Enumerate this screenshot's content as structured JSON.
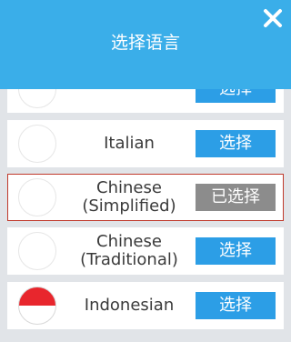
{
  "header": {
    "title": "选择语言",
    "close_icon": "close-icon"
  },
  "colors": {
    "header_bg": "#3aaee9",
    "list_bg": "#e1e4e8",
    "button_blue": "#2c9ee6",
    "button_selected": "#8c8c8c",
    "selected_border": "#c0392b"
  },
  "languages": [
    {
      "label": "",
      "button": "选择",
      "selected": false,
      "flag": "blank-flag"
    },
    {
      "label": "Italian",
      "button": "选择",
      "selected": false,
      "flag": "blank-flag"
    },
    {
      "label": "Chinese\n(Simplified)",
      "button": "已选择",
      "selected": true,
      "flag": "blank-flag"
    },
    {
      "label": "Chinese\n(Traditional)",
      "button": "选择",
      "selected": false,
      "flag": "blank-flag"
    },
    {
      "label": "Indonesian",
      "button": "选择",
      "selected": false,
      "flag": "indonesia-flag"
    }
  ]
}
